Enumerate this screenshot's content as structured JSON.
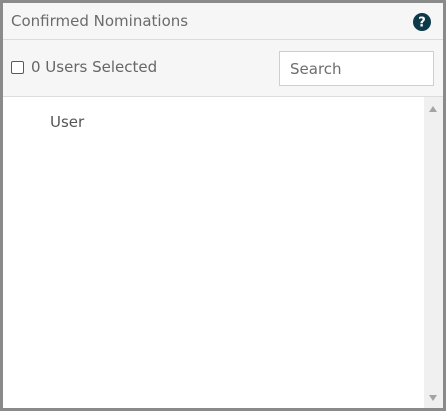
{
  "panel": {
    "title": "Confirmed Nominations",
    "help_icon": "help-circle-icon"
  },
  "toolbar": {
    "selected_count_label": "0 Users Selected",
    "search_placeholder": "Search",
    "search_value": ""
  },
  "list": {
    "column_header": "User",
    "rows": []
  },
  "colors": {
    "help_icon": "#0d3a4a",
    "header_bg": "#f6f6f6",
    "border": "#8a8a8a"
  }
}
